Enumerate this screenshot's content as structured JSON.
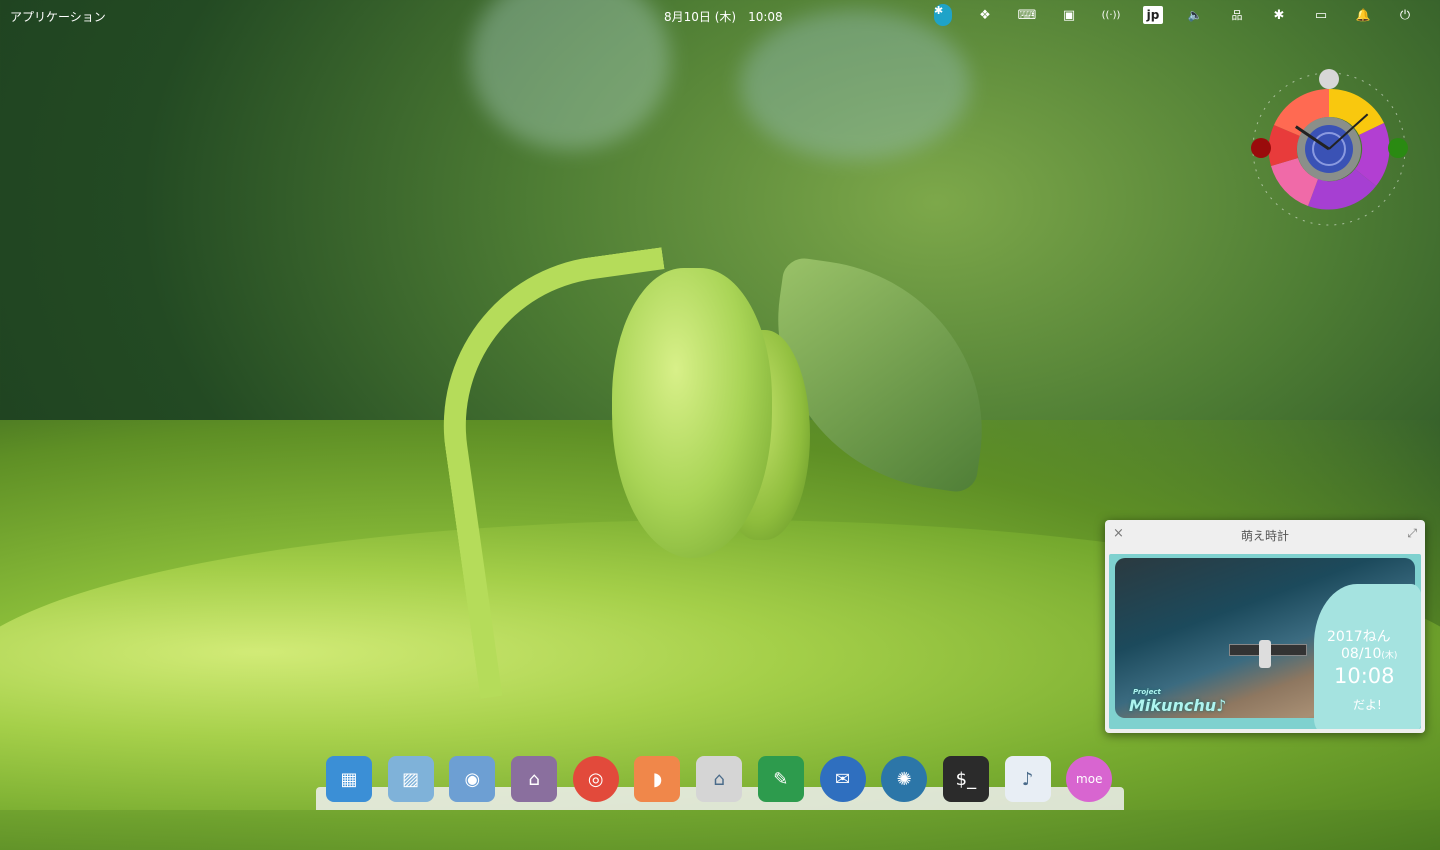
{
  "topbar": {
    "applications_label": "アプリケーション",
    "datetime": "8月10日 (木)　10:08",
    "indicators": [
      {
        "name": "bluetooth-app-icon",
        "glyph": "✱"
      },
      {
        "name": "dropbox-icon",
        "glyph": "❖"
      },
      {
        "name": "keyboard-icon",
        "glyph": "⌨"
      },
      {
        "name": "monitor-icon",
        "glyph": "▣"
      },
      {
        "name": "wireless-icon",
        "glyph": "((·))"
      },
      {
        "name": "input-method-icon",
        "glyph": "jp"
      },
      {
        "name": "volume-icon",
        "glyph": "🔈"
      },
      {
        "name": "network-icon",
        "glyph": "品"
      },
      {
        "name": "bluetooth-icon",
        "glyph": "✱"
      },
      {
        "name": "battery-icon",
        "glyph": "▭"
      },
      {
        "name": "notification-bell-icon",
        "glyph": "🔔"
      },
      {
        "name": "power-icon",
        "glyph": "⏻"
      }
    ]
  },
  "tokei_window": {
    "title": "萌え時計",
    "close_glyph": "×",
    "maximize_glyph": "⤢",
    "year": "2017ねん",
    "date": "08/10",
    "weekday": "(木)",
    "time": "10:08",
    "suffix": "だよ!",
    "brand": "Mikunchu♪",
    "brand_prefix": "Project"
  },
  "clock_widget": {
    "hour": 10,
    "minute": 8
  },
  "dock": {
    "items": [
      {
        "name": "multitasking-view-icon",
        "color": "#3b8fd6",
        "glyph": "▦"
      },
      {
        "name": "photos-icon",
        "color": "#7fb2d9",
        "glyph": "▨"
      },
      {
        "name": "system-settings-icon",
        "color": "#6d9fd3",
        "glyph": "◉"
      },
      {
        "name": "app-center-icon",
        "color": "#8a6f9e",
        "glyph": "⌂"
      },
      {
        "name": "chrome-icon",
        "color": "#e24a3b",
        "glyph": "◎"
      },
      {
        "name": "orange-app-icon",
        "color": "#f0874a",
        "glyph": "◗"
      },
      {
        "name": "files-icon",
        "color": "#d5d5d5",
        "glyph": "⌂"
      },
      {
        "name": "inkscape-icon",
        "color": "#2d9b4d",
        "glyph": "✎"
      },
      {
        "name": "thunderbird-icon",
        "color": "#2f6fbf",
        "glyph": "✉"
      },
      {
        "name": "shutter-icon",
        "color": "#2c76a8",
        "glyph": "✺"
      },
      {
        "name": "terminal-icon",
        "color": "#2b2b2b",
        "glyph": "$_"
      },
      {
        "name": "beatbox-music-icon",
        "color": "#e8eef5",
        "glyph": "♪"
      },
      {
        "name": "moe-tokei-icon",
        "color": "#d865d0",
        "glyph": "moe"
      }
    ]
  }
}
